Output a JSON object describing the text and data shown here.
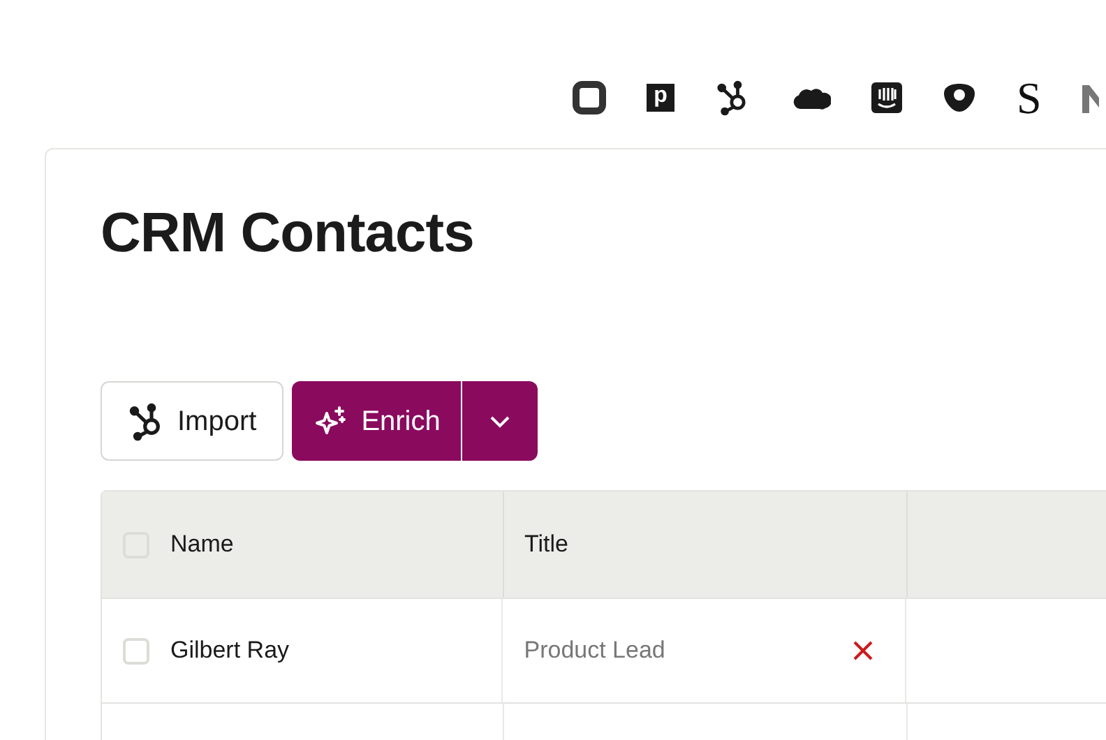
{
  "logos": [
    {
      "kind": "ring"
    },
    {
      "kind": "letter-box",
      "text": "p"
    },
    {
      "kind": "hub"
    },
    {
      "kind": "cloud"
    },
    {
      "kind": "bars"
    },
    {
      "kind": "shield"
    },
    {
      "kind": "letter",
      "text": "S"
    },
    {
      "kind": "cut"
    }
  ],
  "title": "CRM Contacts",
  "buttons": [
    {
      "kind": "import",
      "label": "Import"
    },
    {
      "kind": "enrich",
      "label": "Enrich"
    }
  ],
  "table": {
    "columns": [
      {
        "label": "Name",
        "checked": false
      },
      {
        "label": "Title"
      }
    ],
    "rows": [
      {
        "checked": false,
        "cells": [
          "Gilbert Ray",
          "Product Lead"
        ]
      }
    ]
  }
}
